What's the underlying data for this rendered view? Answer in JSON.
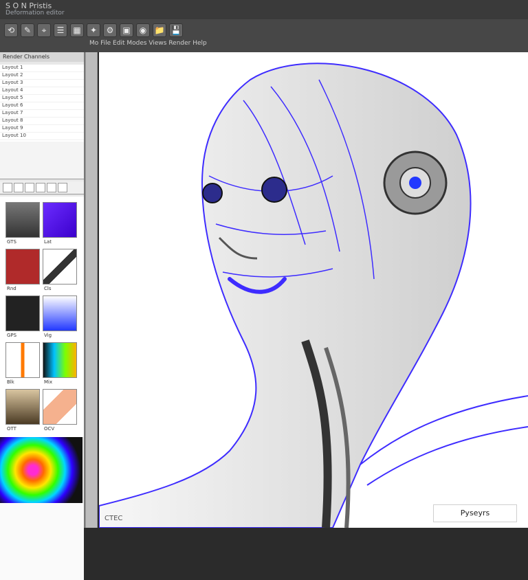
{
  "window": {
    "title": "S O N Pristis",
    "subtitle": "Deformation editor"
  },
  "toolbar": {
    "icons": [
      "refresh-icon",
      "pen-icon",
      "select-icon",
      "layers-icon",
      "grid-icon",
      "brush-icon",
      "settings-icon",
      "image-icon",
      "eye-icon",
      "folder-icon",
      "save-icon"
    ],
    "labels": "Mo  File  Edit  Modes  Views  Render  Help"
  },
  "sidebar": {
    "header": "Render Channels",
    "list_rows": [
      "Layout 1",
      "Layout 2",
      "Layout 3",
      "Layout 4",
      "Layout 5",
      "Layout 6",
      "Layout 7",
      "Layout 8",
      "Layout 9",
      "Layout 10"
    ],
    "swatch_labels": [
      "GTS",
      "Lat",
      "Rnd",
      "Cls",
      "GPS",
      "Vig",
      "Blk",
      "Mix",
      "OTT",
      "OCV"
    ]
  },
  "canvas": {
    "watermark": "Pyseyrs",
    "footer": "CTEC"
  },
  "colors": {
    "accent": "#3e2cff",
    "shade": "#7e7e7e"
  }
}
